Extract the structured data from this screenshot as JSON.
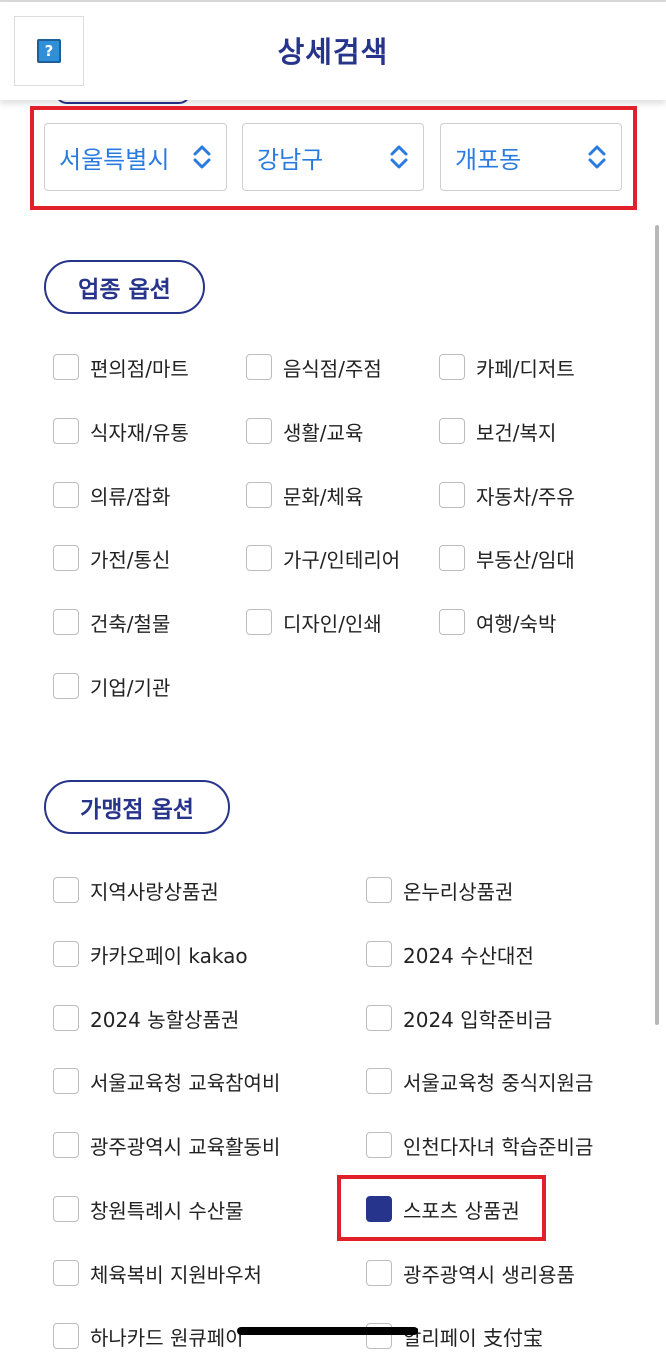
{
  "header": {
    "title": "상세검색",
    "help_glyph": "?",
    "help_icon": "help-icon"
  },
  "region": {
    "city": "서울특별시",
    "district": "강남구",
    "dong": "개포동",
    "chevron_icon": "chevron-up-down-icon",
    "accent_color": "#2a7be0"
  },
  "industry": {
    "title": "업종 옵션",
    "options": [
      "편의점/마트",
      "음식점/주점",
      "카페/디저트",
      "식자재/유통",
      "생활/교육",
      "보건/복지",
      "의류/잡화",
      "문화/체육",
      "자동차/주유",
      "가전/통신",
      "가구/인테리어",
      "부동산/임대",
      "건축/철물",
      "디자인/인쇄",
      "여행/숙박",
      "기업/기관"
    ]
  },
  "merchant": {
    "title": "가맹점 옵션",
    "options": [
      {
        "label": "지역사랑상품권",
        "checked": false
      },
      {
        "label": "온누리상품권",
        "checked": false
      },
      {
        "label": "카카오페이 kakao",
        "checked": false
      },
      {
        "label": "2024 수산대전",
        "checked": false
      },
      {
        "label": "2024 농할상품권",
        "checked": false
      },
      {
        "label": "2024 입학준비금",
        "checked": false
      },
      {
        "label": "서울교육청 교육참여비",
        "checked": false
      },
      {
        "label": "서울교육청 중식지원금",
        "checked": false
      },
      {
        "label": "광주광역시 교육활동비",
        "checked": false
      },
      {
        "label": "인천다자녀 학습준비금",
        "checked": false
      },
      {
        "label": "창원특례시 수산물",
        "checked": false
      },
      {
        "label": "스포츠 상품권",
        "checked": true
      },
      {
        "label": "체육복비 지원바우처",
        "checked": false
      },
      {
        "label": "광주광역시 생리용품",
        "checked": false
      },
      {
        "label": "하나카드 원큐페이",
        "checked": false
      },
      {
        "label": "알리페이 支付宝",
        "checked": false
      }
    ]
  },
  "colors": {
    "brand": "#27348b",
    "highlight": "#e1202a"
  }
}
